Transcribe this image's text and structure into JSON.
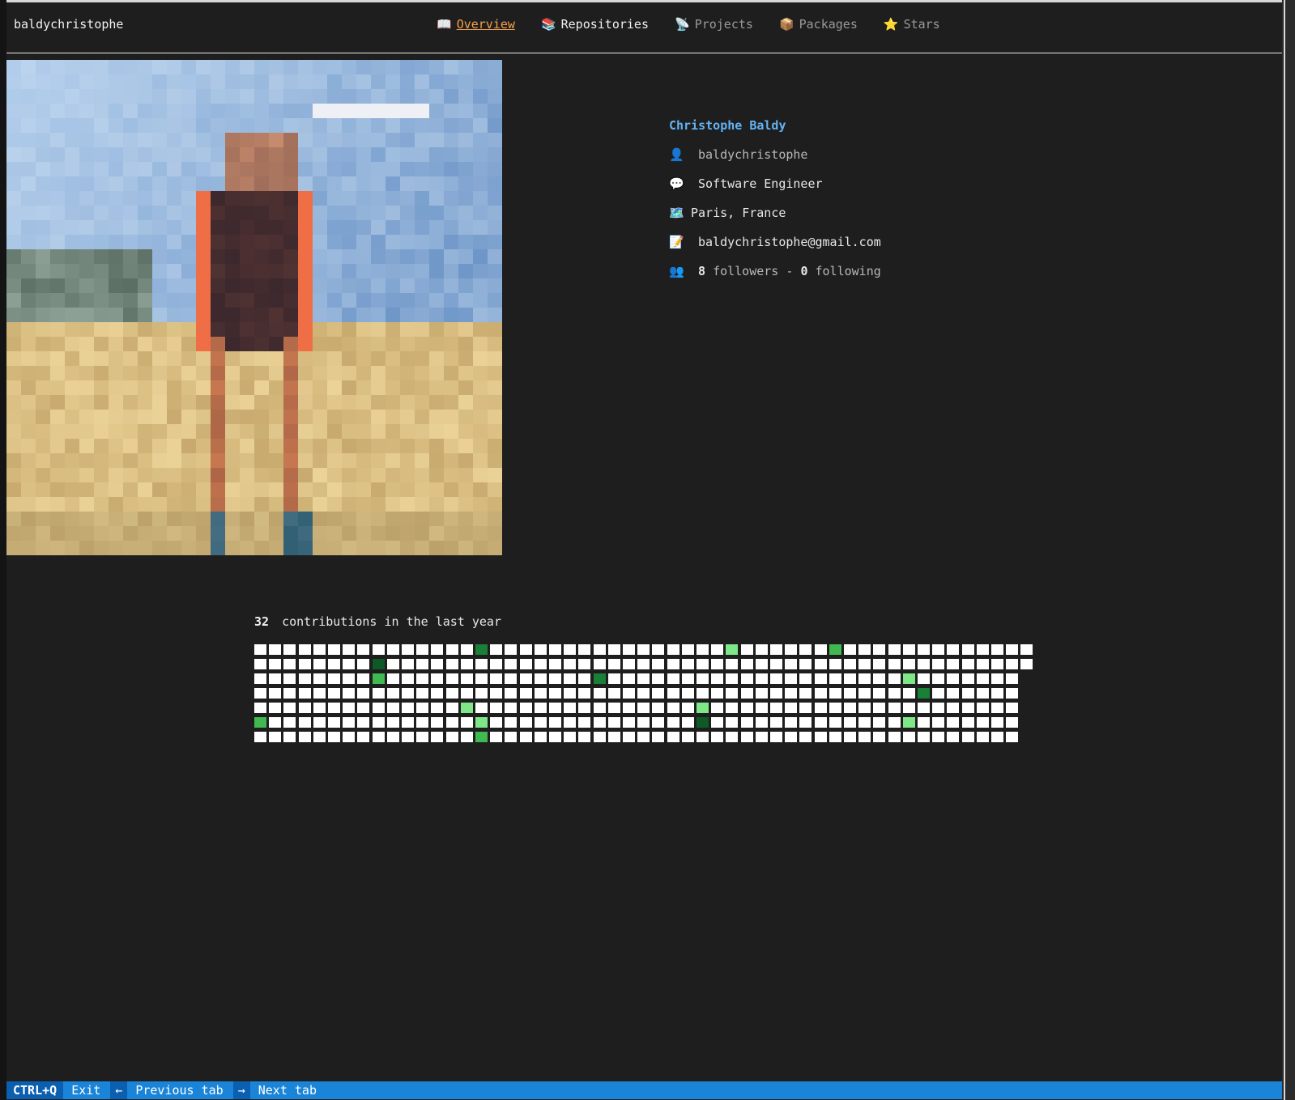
{
  "app": {
    "title": "baldychristophe"
  },
  "tabs": [
    {
      "icon": "📖",
      "label": "Overview",
      "state": "active"
    },
    {
      "icon": "📚",
      "label": "Repositories",
      "state": "bright"
    },
    {
      "icon": "📡",
      "label": "Projects",
      "state": "dim"
    },
    {
      "icon": "📦",
      "label": "Packages",
      "state": "dim"
    },
    {
      "icon": "⭐",
      "label": "Stars",
      "state": "dim"
    }
  ],
  "profile": {
    "name": "Christophe Baldy",
    "username_icon": "👤",
    "username": "baldychristophe",
    "bio_icon": "💬",
    "bio": "Software Engineer",
    "location_icon": "🗺️",
    "location": "Paris, France",
    "email_icon": "📝",
    "email": "baldychristophe@gmail.com",
    "social_icon": "👥",
    "followers": "8",
    "followers_label": "followers -",
    "following": "0",
    "following_label": "following"
  },
  "contributions": {
    "count": "32",
    "label": "contributions in the last year",
    "weeks": 53,
    "days": 7,
    "last_week_days": 2,
    "active": [
      {
        "week": 15,
        "day": 0,
        "level": 3
      },
      {
        "week": 32,
        "day": 0,
        "level": 1
      },
      {
        "week": 39,
        "day": 0,
        "level": 2
      },
      {
        "week": 8,
        "day": 1,
        "level": 4
      },
      {
        "week": 8,
        "day": 2,
        "level": 2
      },
      {
        "week": 23,
        "day": 2,
        "level": 3
      },
      {
        "week": 44,
        "day": 2,
        "level": 1
      },
      {
        "week": 45,
        "day": 3,
        "level": 3
      },
      {
        "week": 14,
        "day": 4,
        "level": 1
      },
      {
        "week": 30,
        "day": 4,
        "level": 1
      },
      {
        "week": 0,
        "day": 5,
        "level": 2
      },
      {
        "week": 15,
        "day": 5,
        "level": 1
      },
      {
        "week": 30,
        "day": 5,
        "level": 4
      },
      {
        "week": 44,
        "day": 5,
        "level": 1
      },
      {
        "week": 15,
        "day": 6,
        "level": 2
      }
    ]
  },
  "footer": {
    "exit_key": "CTRL+Q",
    "exit_label": "Exit",
    "prev_key": "←",
    "prev_label": "Previous tab",
    "next_key": "→",
    "next_label": "Next tab"
  }
}
